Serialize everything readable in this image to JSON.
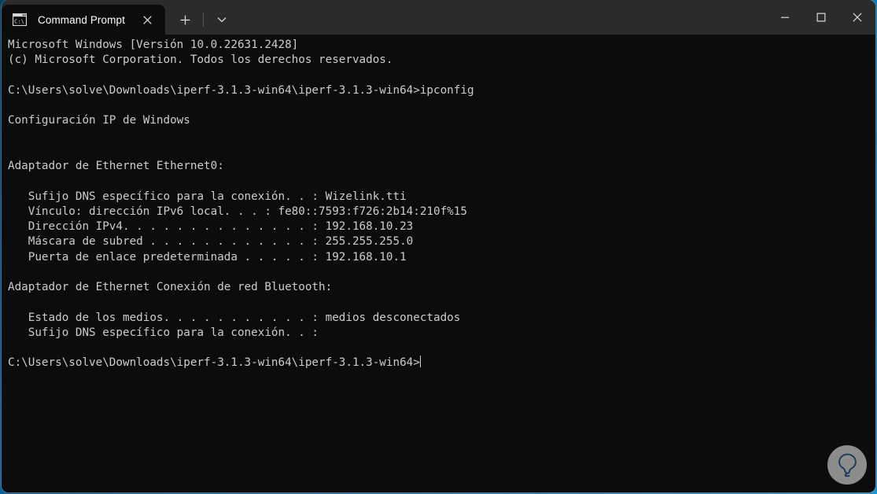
{
  "window": {
    "app_title": "Command Prompt",
    "controls": {
      "minimize_label": "Minimize",
      "maximize_label": "Maximize",
      "close_label": "Close"
    }
  },
  "tabbar": {
    "tabs": [
      {
        "label": "Command Prompt",
        "icon": "terminal-icon",
        "icon_text": "C:\\",
        "close_label": "Close tab",
        "active": true
      }
    ],
    "new_tab_label": "New tab",
    "dropdown_label": "Open a new tab with a specific profile"
  },
  "terminal": {
    "colors": {
      "background": "#0c0c0c",
      "foreground": "#cccccc",
      "titlebar": "#2b2b2b",
      "desktop_accent": "#1b9ad6"
    },
    "lines": [
      "Microsoft Windows [Versión 10.0.22631.2428]",
      "(c) Microsoft Corporation. Todos los derechos reservados.",
      "",
      "C:\\Users\\solve\\Downloads\\iperf-3.1.3-win64\\iperf-3.1.3-win64>ipconfig",
      "",
      "Configuración IP de Windows",
      "",
      "",
      "Adaptador de Ethernet Ethernet0:",
      "",
      "   Sufijo DNS específico para la conexión. . : Wizelink.tti",
      "   Vínculo: dirección IPv6 local. . . : fe80::7593:f726:2b14:210f%15",
      "   Dirección IPv4. . . . . . . . . . . . . . : 192.168.10.23",
      "   Máscara de subred . . . . . . . . . . . . : 255.255.255.0",
      "   Puerta de enlace predeterminada . . . . . : 192.168.10.1",
      "",
      "Adaptador de Ethernet Conexión de red Bluetooth:",
      "",
      "   Estado de los medios. . . . . . . . . . . : medios desconectados",
      "   Sufijo DNS específico para la conexión. . :",
      ""
    ],
    "prompt": "C:\\Users\\solve\\Downloads\\iperf-3.1.3-win64\\iperf-3.1.3-win64>",
    "command_entered": "ipconfig",
    "network": {
      "os_name": "Microsoft Windows",
      "os_version": "10.0.22631.2428",
      "copyright": "(c) Microsoft Corporation. Todos los derechos reservados.",
      "section_title": "Configuración IP de Windows",
      "adapters": [
        {
          "name": "Adaptador de Ethernet Ethernet0:",
          "fields": [
            {
              "label": "Sufijo DNS específico para la conexión",
              "value": "Wizelink.tti"
            },
            {
              "label": "Vínculo: dirección IPv6 local",
              "value": "fe80::7593:f726:2b14:210f%15"
            },
            {
              "label": "Dirección IPv4",
              "value": "192.168.10.23"
            },
            {
              "label": "Máscara de subred",
              "value": "255.255.255.0"
            },
            {
              "label": "Puerta de enlace predeterminada",
              "value": "192.168.10.1"
            }
          ]
        },
        {
          "name": "Adaptador de Ethernet Conexión de red Bluetooth:",
          "fields": [
            {
              "label": "Estado de los medios",
              "value": "medios desconectados"
            },
            {
              "label": "Sufijo DNS específico para la conexión",
              "value": ""
            }
          ]
        }
      ]
    }
  },
  "overlay": {
    "help_badge_name": "lightbulb-logo-icon",
    "help_badge_color": "#1b3a5c"
  }
}
